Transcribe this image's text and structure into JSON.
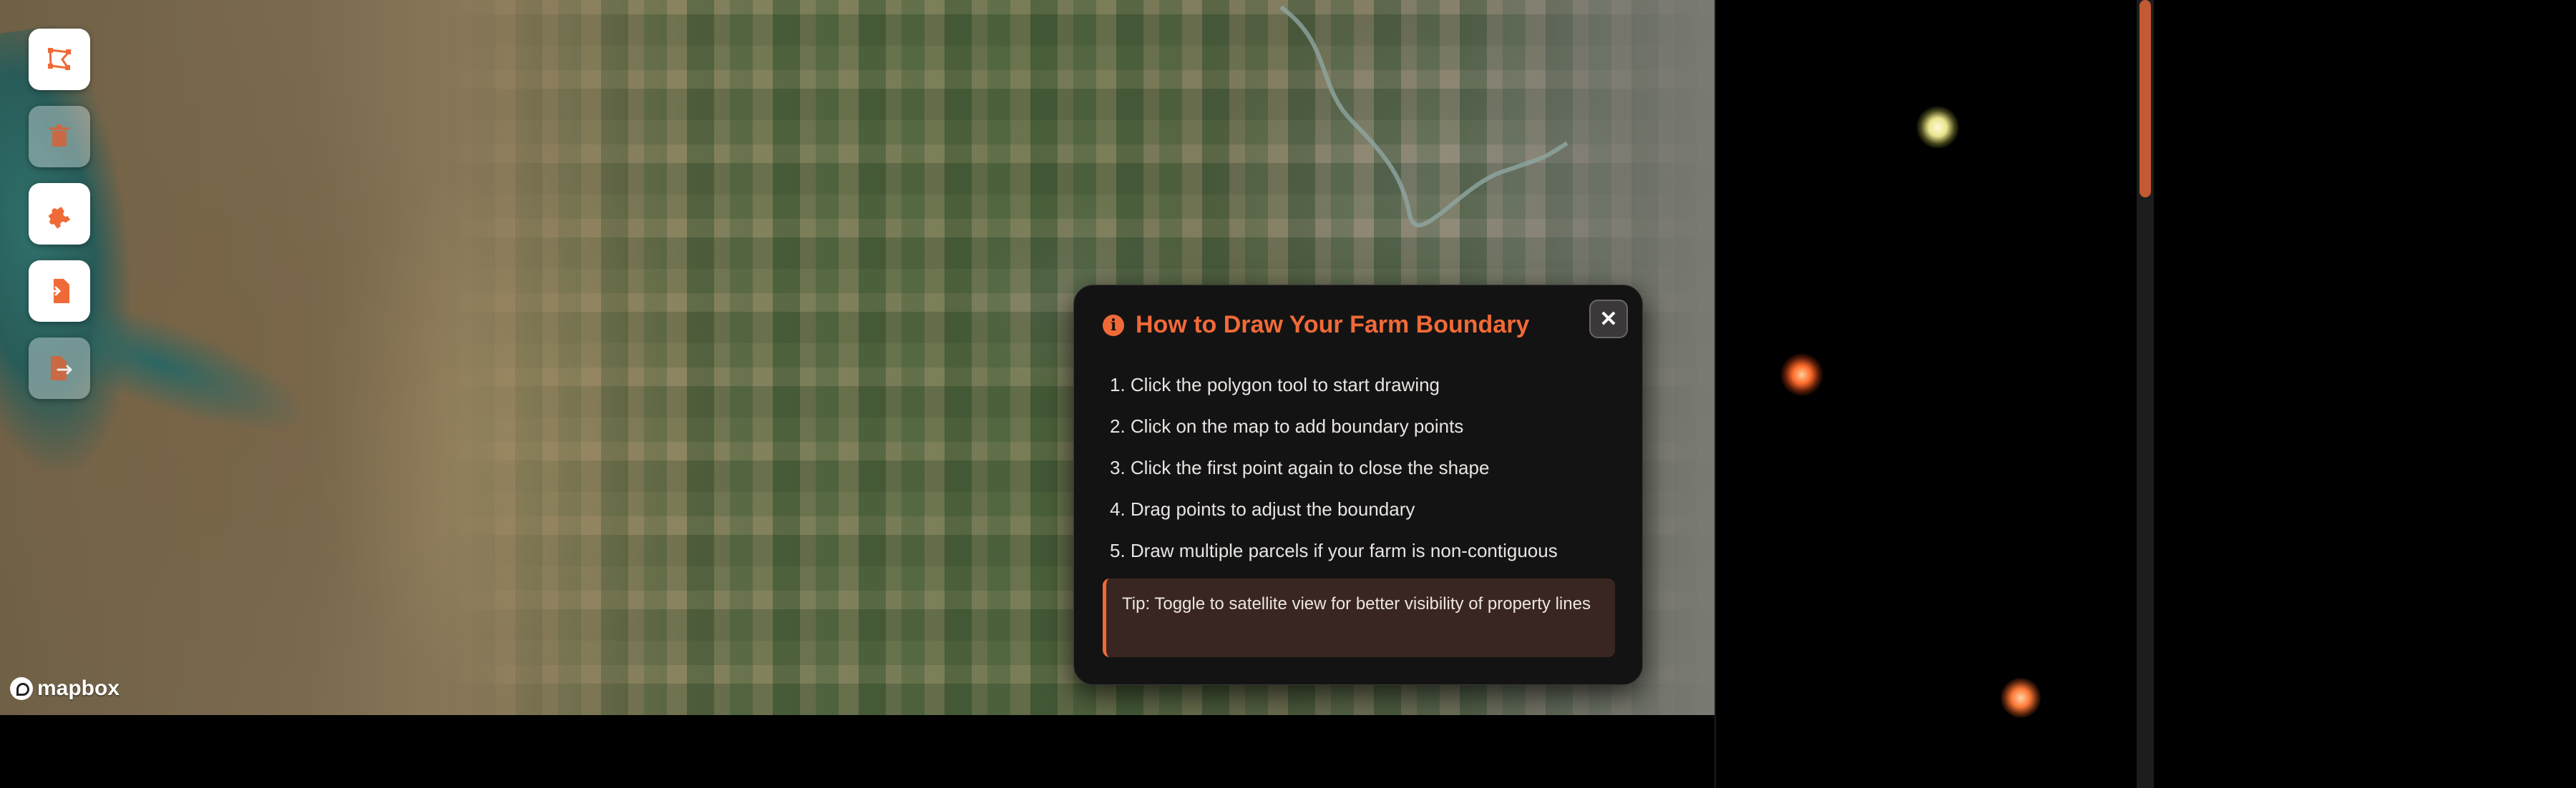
{
  "map": {
    "attribution_logo": "mapbox"
  },
  "toolbar": {
    "items": [
      {
        "name": "polygon-tool",
        "icon": "polygon-draw-icon",
        "enabled": true
      },
      {
        "name": "delete-tool",
        "icon": "trash-icon",
        "enabled": false
      },
      {
        "name": "combine-tool",
        "icon": "puzzle-icon",
        "enabled": true
      },
      {
        "name": "import-tool",
        "icon": "file-import-icon",
        "enabled": true
      },
      {
        "name": "export-tool",
        "icon": "file-export-icon",
        "enabled": false
      }
    ]
  },
  "dialog": {
    "title": "How to Draw Your Farm Boundary",
    "close_label": "✕",
    "steps": [
      "1. Click the polygon tool to start drawing",
      "2. Click on the map to add boundary points",
      "3. Click the first point again to close the shape",
      "4. Drag points to adjust the boundary",
      "5. Draw multiple parcels if your farm is non-contiguous"
    ],
    "tip": "Tip: Toggle to satellite view for better visibility of property lines"
  },
  "colors": {
    "accent": "#f06a38",
    "dialog_bg": "#141313",
    "tip_bg": "#3a2620",
    "scroll_thumb": "#c25a34"
  }
}
